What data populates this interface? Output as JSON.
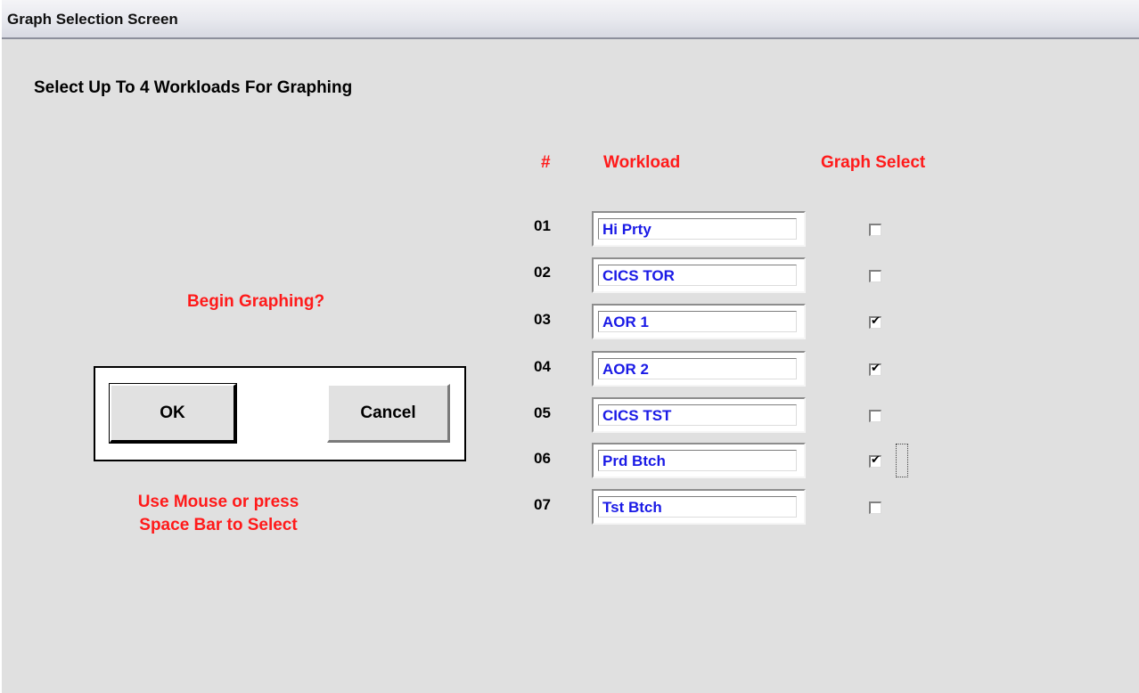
{
  "window": {
    "title": "Graph Selection Screen"
  },
  "heading": "Select Up To 4 Workloads For Graphing",
  "columns": {
    "number": "#",
    "workload": "Workload",
    "graph_select": "Graph Select"
  },
  "rows": [
    {
      "num": "01",
      "workload": "Hi Prty",
      "selected": false
    },
    {
      "num": "02",
      "workload": "CICS TOR",
      "selected": false
    },
    {
      "num": "03",
      "workload": "AOR 1",
      "selected": true
    },
    {
      "num": "04",
      "workload": "AOR 2",
      "selected": true
    },
    {
      "num": "05",
      "workload": "CICS TST",
      "selected": false
    },
    {
      "num": "06",
      "workload": "Prd Btch",
      "selected": true
    },
    {
      "num": "07",
      "workload": "Tst Btch",
      "selected": false
    }
  ],
  "prompt": "Begin Graphing?",
  "buttons": {
    "ok": "OK",
    "cancel": "Cancel"
  },
  "hint": {
    "line1": "Use Mouse or press",
    "line2": "Space Bar to Select"
  },
  "colors": {
    "label_red": "#ff1a1a",
    "field_text_blue": "#1a1ae6",
    "background": "#e0e0e0"
  }
}
